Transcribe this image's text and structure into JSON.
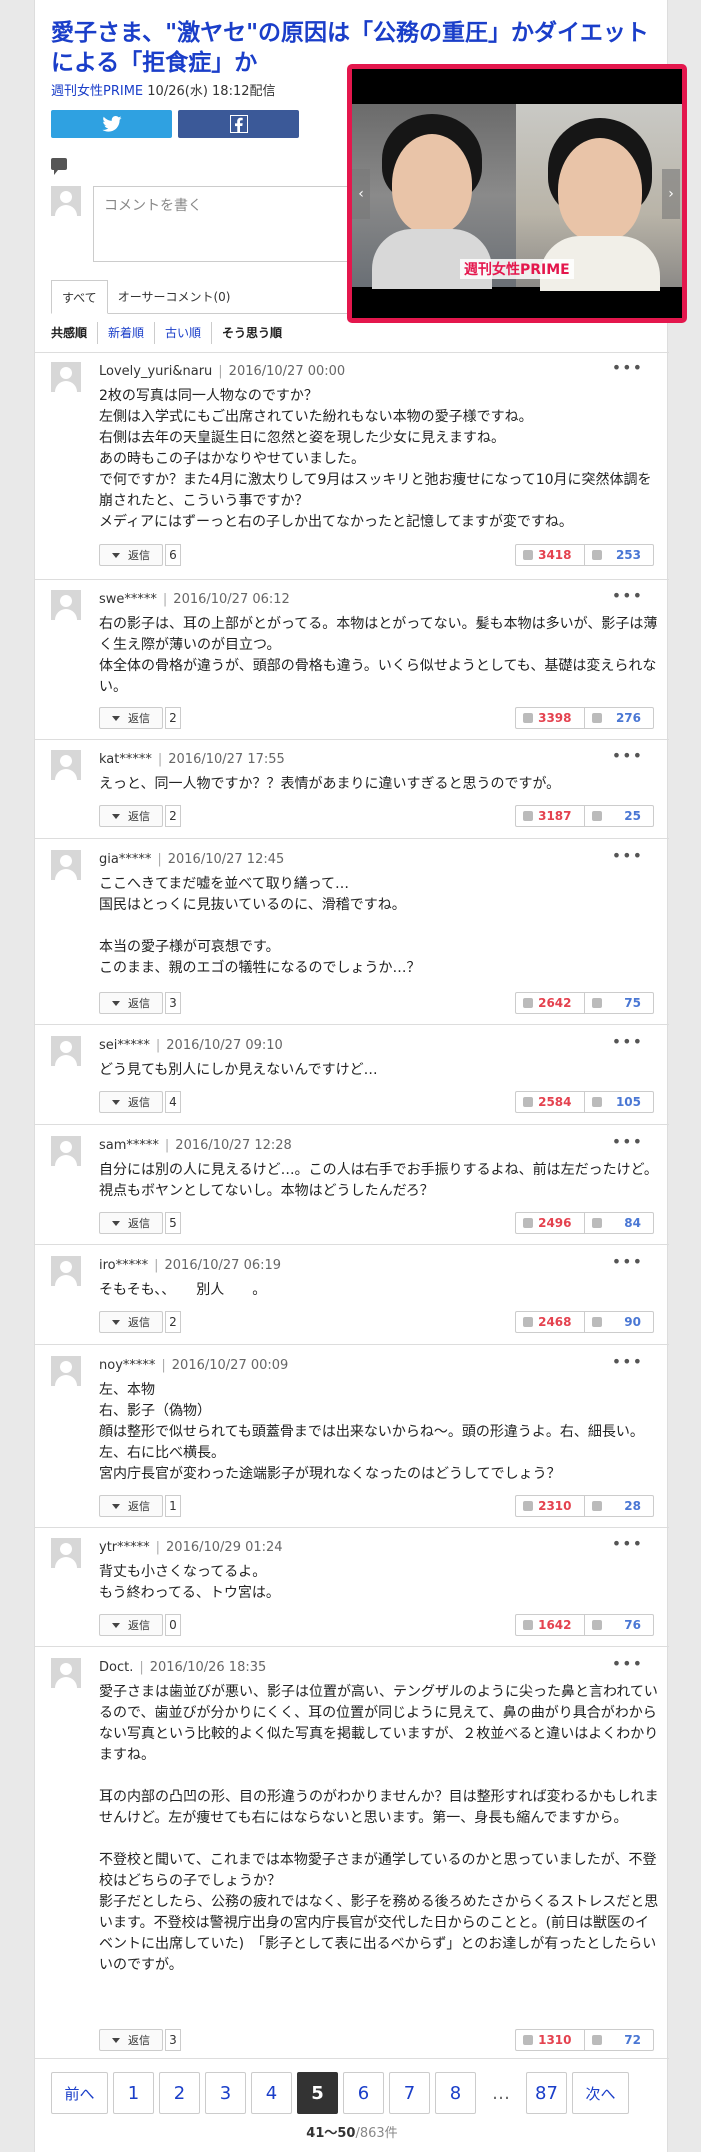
{
  "article": {
    "title": "愛子さま、\"激ヤセ\"の原因は「公務の重圧」かダイエットによる「拒食症」か",
    "source": "週刊女性PRIME",
    "datetime": "10/26(水) 18:12配信",
    "video_logo": "週刊女性PRIME"
  },
  "comment_form": {
    "placeholder": "コメントを書く"
  },
  "tabs": [
    "すべて",
    "オーサーコメント(0)"
  ],
  "sorts": [
    "共感順",
    "新着順",
    "古い順",
    "そう思う順"
  ],
  "reply_label": "返信",
  "more_label": "•••",
  "comments": [
    {
      "user": "Lovely_yuri&naru",
      "date": "2016/10/27 00:00",
      "text": "2枚の写真は同一人物なのですか？\n左側は入学式にもご出席されていた紛れもない本物の愛子様ですね。\n右側は去年の天皇誕生日に忽然と姿を現した少女に見えますね。\nあの時もこの子はかなりやせていました。\nで何ですか？また4月に激太りして9月はスッキリと弛お痩せになって10月に突然体調を崩されたと、こういう事ですか？\nメディアにはずーっと右の子しか出てなかったと記憶してますが変ですね。",
      "replies": "6",
      "good": "3418",
      "bad": "253"
    },
    {
      "user": "swe*****",
      "date": "2016/10/27 06:12",
      "text": "右の影子は、耳の上部がとがってる。本物はとがってない。髪も本物は多いが、影子は薄く生え際が薄いのが目立つ。\n体全体の骨格が違うが、頭部の骨格も違う。いくら似せようとしても、基礎は変えられない。",
      "replies": "2",
      "good": "3398",
      "bad": "276"
    },
    {
      "user": "kat*****",
      "date": "2016/10/27 17:55",
      "text": "えっと、同一人物ですか？？表情があまりに違いすぎると思うのですが。",
      "replies": "2",
      "good": "3187",
      "bad": "25"
    },
    {
      "user": "gia*****",
      "date": "2016/10/27 12:45",
      "text": "ここへきてまだ嘘を並べて取り繕って…\n国民はとっくに見抜いているのに、滑稽ですね。\n\n本当の愛子様が可哀想です。\nこのまま、親のエゴの犠牲になるのでしょうか…？",
      "replies": "3",
      "good": "2642",
      "bad": "75"
    },
    {
      "user": "sei*****",
      "date": "2016/10/27 09:10",
      "text": "どう見ても別人にしか見えないんですけど…",
      "replies": "4",
      "good": "2584",
      "bad": "105"
    },
    {
      "user": "sam*****",
      "date": "2016/10/27 12:28",
      "text": "自分には別の人に見えるけど…。この人は右手でお手振りするよね、前は左だったけど。視点もボヤンとしてないし。本物はどうしたんだろ？",
      "replies": "5",
      "good": "2496",
      "bad": "84"
    },
    {
      "user": "iro*****",
      "date": "2016/10/27 06:19",
      "text": "そもそも、、　　別人　　。",
      "replies": "2",
      "good": "2468",
      "bad": "90"
    },
    {
      "user": "noy*****",
      "date": "2016/10/27 00:09",
      "text": "左、本物\n右、影子（偽物）\n顔は整形で似せられても頭蓋骨までは出来ないからね〜。頭の形違うよ。右、細長い。左、右に比べ横長。\n宮内庁長官が変わった途端影子が現れなくなったのはどうしてでしょう？",
      "replies": "1",
      "good": "2310",
      "bad": "28"
    },
    {
      "user": "ytr*****",
      "date": "2016/10/29 01:24",
      "text": "背丈も小さくなってるよ。\nもう終わってる、トウ宮は。",
      "replies": "0",
      "good": "1642",
      "bad": "76"
    },
    {
      "user": "Doct.",
      "date": "2016/10/26 18:35",
      "text": "愛子さまは歯並びが悪い、影子は位置が高い、テングザルのように尖った鼻と言われているので、歯並びが分かりにくく、耳の位置が同じように見えて、鼻の曲がり具合がわからない写真という比較的よく似た写真を掲載していますが、２枚並べると違いはよくわかりますね。\n\n耳の内部の凸凹の形、目の形違うのがわかりませんか？目は整形すれば変わるかもしれませんけど。左が痩せても右にはならないと思います。第一、身長も縮んでますから。\n\n不登校と聞いて、これまでは本物愛子さまが通学しているのかと思っていましたが、不登校はどちらの子でしょうか？\n影子だとしたら、公務の疲れではなく、影子を務める後ろめたさからくるストレスだと思います。不登校は警視庁出身の宮内庁長官が交代した日からのことと。(前日は獣医のイベントに出席していた)　「影子として表に出るべからず」とのお達しが有ったとしたらいいのですが。",
      "replies": "3",
      "good": "1310",
      "bad": "72"
    }
  ],
  "pager": {
    "prev": "前へ",
    "next": "次へ",
    "pages": [
      "1",
      "2",
      "3",
      "4",
      "5",
      "6",
      "7",
      "8"
    ],
    "current": "5",
    "ellipsis": "…",
    "last": "87",
    "range": "41〜50",
    "total": "/863件"
  }
}
